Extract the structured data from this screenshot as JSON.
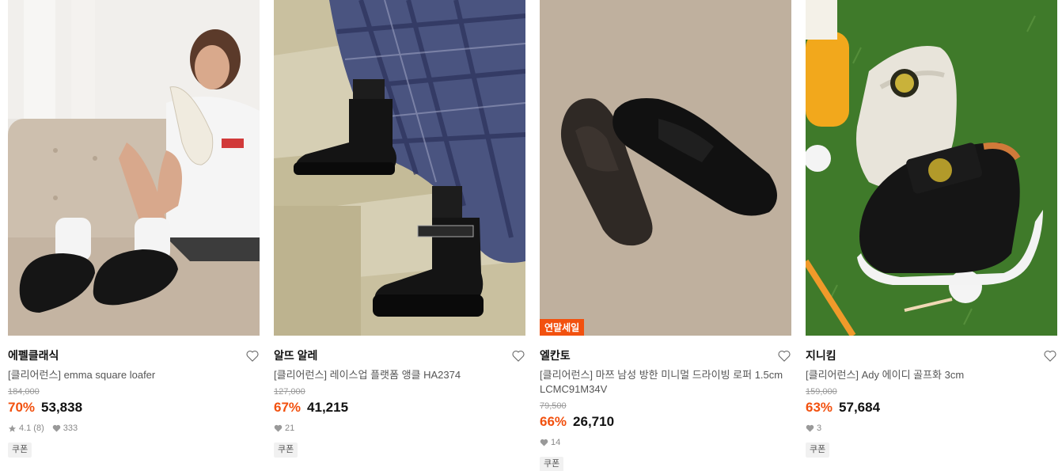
{
  "products": [
    {
      "brand": "에펠클래식",
      "title": "[클리어런스] emma square loafer",
      "original_price": "184,000",
      "discount": "70%",
      "price": "53,838",
      "rating": "4.1",
      "review_count": "(8)",
      "likes": "333",
      "tag": "쿠폰",
      "image_alt": "Woman on sofa wearing black loafers holding cream loafer"
    },
    {
      "brand": "알뜨 알레",
      "title": "[클리어런스] 레이스업 플랫폼 앵클 HA2374",
      "original_price": "127,000",
      "discount": "67%",
      "price": "41,215",
      "likes": "21",
      "tag": "쿠폰",
      "image_alt": "Black lace-up platform ankle boots on stairs"
    },
    {
      "brand": "엘칸토",
      "title": "[클리어런스] 마쯔 남성 방한 미니멀 드라이빙 로퍼 1.5cm LCMC91M34V",
      "original_price": "79,500",
      "discount": "66%",
      "price": "26,710",
      "likes": "14",
      "tag": "쿠폰",
      "badge": "연말세일",
      "image_alt": "Pair of black driving loafers on beige background"
    },
    {
      "brand": "지니킴",
      "title": "[클리어런스] Ady 에이디 골프화 3cm",
      "original_price": "159,000",
      "discount": "63%",
      "price": "57,684",
      "likes": "3",
      "tag": "쿠폰",
      "image_alt": "Golf shoes on grass with golf balls"
    }
  ],
  "colors": {
    "accent": "#f2510f",
    "text": "#111111",
    "muted": "#888888"
  },
  "icons": {
    "wishlist": "heart-outline-icon",
    "rating": "star-icon",
    "likes": "heart-filled-icon"
  }
}
